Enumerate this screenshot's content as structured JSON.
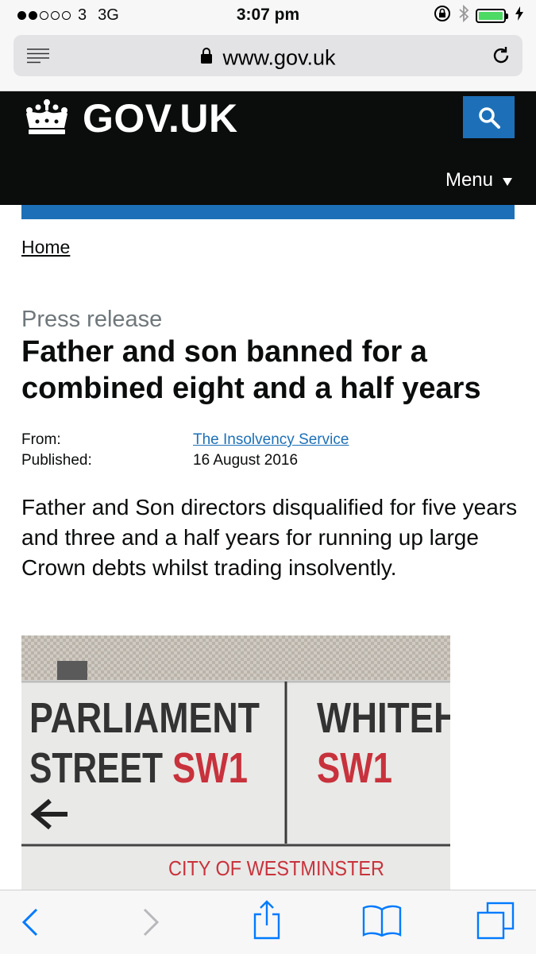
{
  "status_bar": {
    "carrier": "3",
    "network": "3G",
    "time": "3:07 pm"
  },
  "browser": {
    "url": "www.gov.uk"
  },
  "header": {
    "logo_text": "GOV.UK",
    "menu_label": "Menu"
  },
  "breadcrumb": {
    "home": "Home"
  },
  "article": {
    "document_type": "Press release",
    "title": "Father and son banned for a combined eight and a half years",
    "from_label": "From:",
    "from_value": "The Insolvency Service",
    "published_label": "Published:",
    "published_value": "16 August 2016",
    "summary": "Father and Son directors disqualified for five years and three and a half years for running up large Crown debts whilst trading insolvently."
  },
  "hero_image": {
    "sign_left_line1": "PARLIAMENT",
    "sign_left_line2": "STREET",
    "sign_left_code": "SW1",
    "sign_right_line1": "WHITEH",
    "sign_right_code": "SW1",
    "sign_footer": "CITY OF WESTMINSTER"
  },
  "icons": {
    "status": [
      "signal-dots-icon",
      "rotation-lock-icon",
      "bluetooth-icon",
      "battery-icon",
      "charging-icon"
    ],
    "browser": [
      "reader-icon",
      "lock-icon",
      "reload-icon"
    ],
    "header": [
      "crown-icon",
      "search-icon",
      "menu-triangle-icon"
    ],
    "toolbar": [
      "back-icon",
      "forward-icon",
      "share-icon",
      "bookmarks-icon",
      "tabs-icon"
    ]
  },
  "colors": {
    "govuk_black": "#0b0c0c",
    "govuk_blue": "#1d70b8",
    "secondary_text": "#6f777b",
    "ios_blue": "#007aff",
    "battery_green": "#4cd964",
    "sign_red": "#c8323c"
  }
}
